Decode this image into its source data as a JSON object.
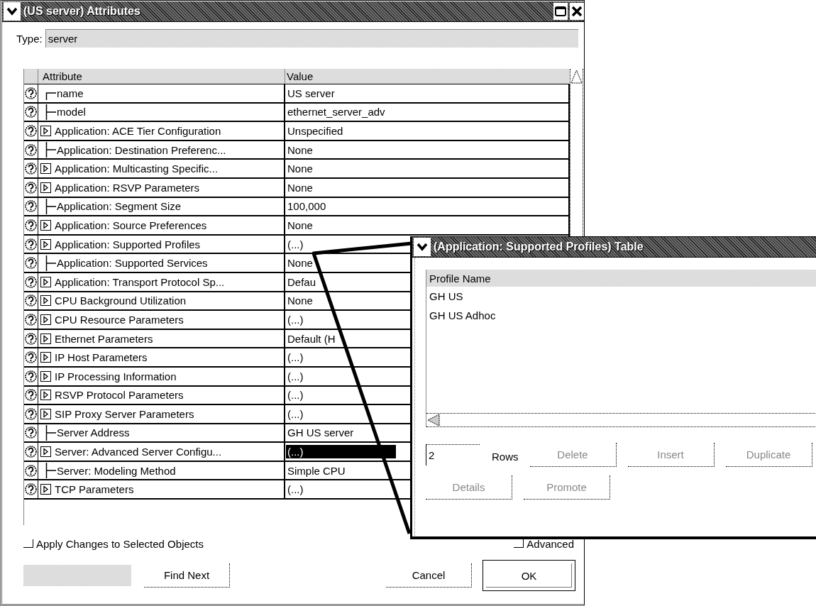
{
  "main_window": {
    "title": "(US server) Attributes",
    "type_label": "Type:",
    "type_value": "server",
    "table": {
      "columns": [
        "Attribute",
        "Value"
      ],
      "rows": [
        {
          "attribute": "name",
          "value": "US server",
          "kind": "leaf",
          "selected": false
        },
        {
          "attribute": "model",
          "value": "ethernet_server_adv",
          "kind": "leaf",
          "selected": false
        },
        {
          "attribute": "Application: ACE Tier Configuration",
          "value": "Unspecified",
          "kind": "group",
          "selected": false
        },
        {
          "attribute": "Application: Destination Preferenc...",
          "value": "None",
          "kind": "leaf",
          "selected": false
        },
        {
          "attribute": "Application: Multicasting Specific...",
          "value": "None",
          "kind": "group",
          "selected": false
        },
        {
          "attribute": "Application: RSVP Parameters",
          "value": "None",
          "kind": "group",
          "selected": false
        },
        {
          "attribute": "Application: Segment Size",
          "value": "100,000",
          "kind": "leaf",
          "selected": false
        },
        {
          "attribute": "Application: Source Preferences",
          "value": "None",
          "kind": "group",
          "selected": false
        },
        {
          "attribute": "Application: Supported Profiles",
          "value": "(...)",
          "kind": "group",
          "selected": false
        },
        {
          "attribute": "Application: Supported Services",
          "value": "None",
          "kind": "leaf",
          "selected": false
        },
        {
          "attribute": "Application: Transport Protocol Sp...",
          "value": "Defau",
          "kind": "group",
          "selected": false
        },
        {
          "attribute": "CPU Background Utilization",
          "value": "None",
          "kind": "group",
          "selected": false
        },
        {
          "attribute": "CPU Resource Parameters",
          "value": "(...)",
          "kind": "group",
          "selected": false
        },
        {
          "attribute": "Ethernet Parameters",
          "value": "Default (H",
          "kind": "group",
          "selected": false
        },
        {
          "attribute": "IP Host Parameters",
          "value": "(...)",
          "kind": "group",
          "selected": false
        },
        {
          "attribute": "IP Processing Information",
          "value": "(...)",
          "kind": "group",
          "selected": false
        },
        {
          "attribute": "RSVP Protocol Parameters",
          "value": "(...)",
          "kind": "group",
          "selected": false
        },
        {
          "attribute": "SIP Proxy Server Parameters",
          "value": "(...)",
          "kind": "group",
          "selected": false
        },
        {
          "attribute": "Server Address",
          "value": "GH US server",
          "kind": "leaf",
          "selected": false
        },
        {
          "attribute": "Server: Advanced Server Configu...",
          "value": "(...)",
          "kind": "group",
          "selected": true
        },
        {
          "attribute": "Server: Modeling Method",
          "value": "Simple CPU",
          "kind": "leaf",
          "selected": false
        },
        {
          "attribute": "TCP Parameters",
          "value": "(...)",
          "kind": "group",
          "selected": false
        }
      ]
    },
    "apply_checkbox": {
      "label": "Apply Changes to Selected Objects",
      "checked": false
    },
    "advanced_checkbox": {
      "label": "Advanced",
      "checked": false
    },
    "buttons": [
      {
        "label": "Find Next",
        "default": false
      },
      {
        "label": "Cancel",
        "default": false
      },
      {
        "label": "OK",
        "default": true
      }
    ]
  },
  "table_window": {
    "title": "(Application: Supported Profiles) Table",
    "table": {
      "columns": [
        "Profile Name"
      ],
      "rows": [
        "GH US",
        "GH US Adhoc"
      ]
    },
    "row_count": "2",
    "row_count_label": "Rows",
    "buttons": [
      {
        "label": "Delete",
        "disabled": true
      },
      {
        "label": "Insert",
        "disabled": true
      },
      {
        "label": "Duplicate",
        "disabled": true
      },
      {
        "label": "Details",
        "disabled": true
      },
      {
        "label": "Promote",
        "disabled": true
      }
    ]
  }
}
